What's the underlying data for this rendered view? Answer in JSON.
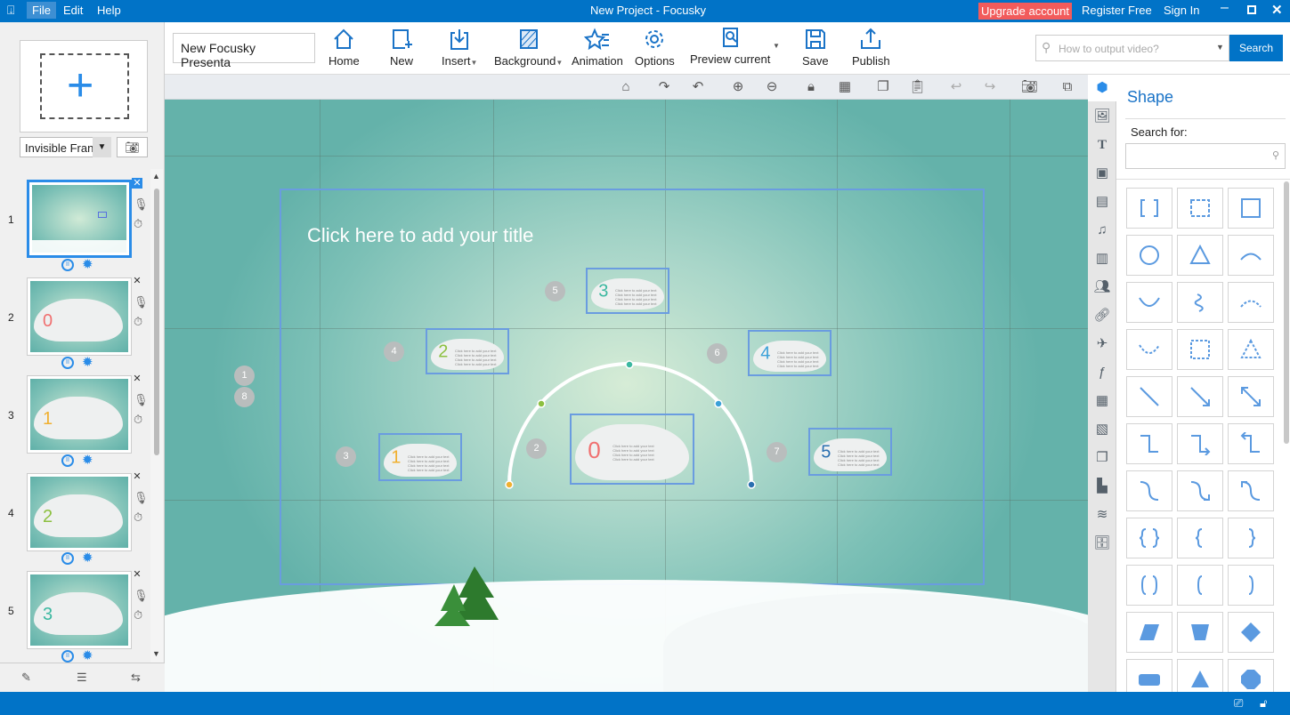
{
  "titlebar": {
    "menus": [
      "File",
      "Edit",
      "Help"
    ],
    "title": "New Project - Focusky",
    "upgrade": "Upgrade account",
    "register": "Register Free",
    "signin": "Sign In"
  },
  "toolbar": {
    "project_name": "New Focusky Presenta",
    "buttons": {
      "home": "Home",
      "new": "New",
      "insert": "Insert",
      "background": "Background",
      "animation": "Animation",
      "options": "Options",
      "preview": "Preview current",
      "save": "Save",
      "publish": "Publish"
    },
    "search_placeholder": "How to output video?",
    "search_button": "Search"
  },
  "left": {
    "frame_type": "Invisible Fran",
    "slides": [
      {
        "num": "1",
        "digit": ""
      },
      {
        "num": "2",
        "digit": "0",
        "color": "#f07070"
      },
      {
        "num": "3",
        "digit": "1",
        "color": "#f0b030"
      },
      {
        "num": "4",
        "digit": "2",
        "color": "#8cc040"
      },
      {
        "num": "5",
        "digit": "3",
        "color": "#3bb8a0"
      }
    ]
  },
  "canvas": {
    "title_placeholder": "Click here to add your title",
    "cloud_text": "Click here to add your text",
    "clouds": [
      {
        "digit": "0",
        "color": "#f07070"
      },
      {
        "digit": "1",
        "color": "#f0b030"
      },
      {
        "digit": "2",
        "color": "#8cc040"
      },
      {
        "digit": "3",
        "color": "#3bb8a0"
      },
      {
        "digit": "4",
        "color": "#3aa0d8"
      },
      {
        "digit": "5",
        "color": "#2a6fb0"
      }
    ],
    "badges": [
      "1",
      "8",
      "5",
      "4",
      "6",
      "3",
      "2",
      "7"
    ],
    "arc_points": [
      "#f0b030",
      "#8cc040",
      "#3bb8a0",
      "#3aa0d8",
      "#2a6fb0"
    ]
  },
  "panel": {
    "title": "Shape",
    "search_label": "Search for:"
  },
  "colors": {
    "brand": "#0173c7",
    "upgrade": "#f25b5b",
    "accent": "#2a8ce8"
  }
}
